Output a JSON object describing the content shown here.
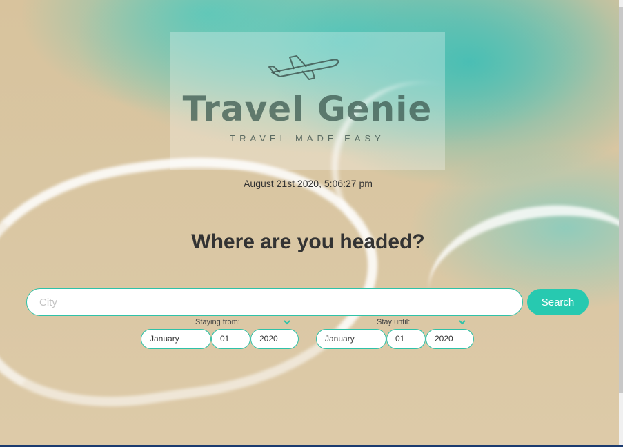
{
  "logo": {
    "title": "Travel Genie",
    "tagline": "TRAVEL MADE EASY",
    "icon": "airplane-icon"
  },
  "datetime": "August 21st 2020, 5:06:27 pm",
  "headline": "Where are you headed?",
  "search": {
    "placeholder": "City",
    "value": "",
    "button_label": "Search"
  },
  "dates": {
    "from_label": "Staying from:",
    "until_label": "Stay until:",
    "from": {
      "month": "January",
      "day": "01",
      "year": "2020"
    },
    "until": {
      "month": "January",
      "day": "01",
      "year": "2020"
    }
  },
  "colors": {
    "accent": "#27c9b0",
    "border": "#2fc2a8",
    "text": "#333333"
  }
}
